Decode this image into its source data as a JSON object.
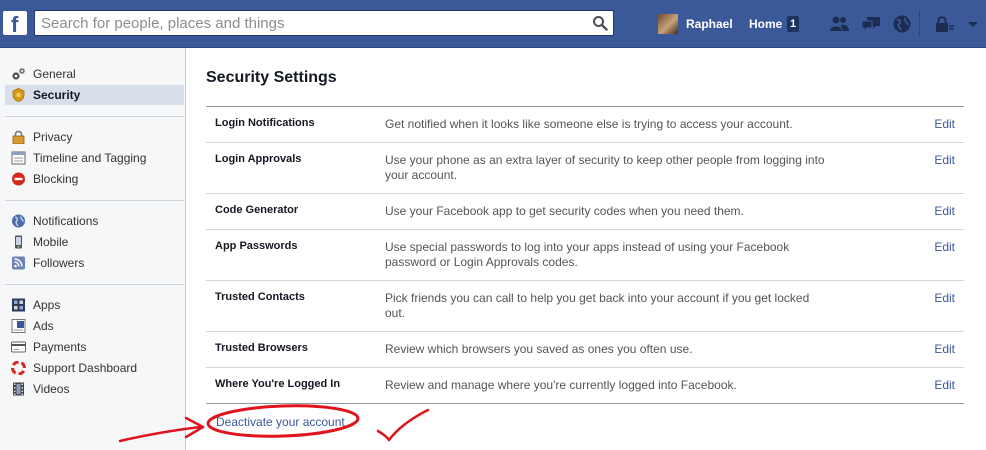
{
  "search": {
    "placeholder": "Search for people, places and things"
  },
  "header": {
    "logo_letter": "f",
    "user_name": "Raphael",
    "home_label": "Home",
    "home_count": "1"
  },
  "sidebar": {
    "items": [
      {
        "label": "General",
        "icon": "gears-icon"
      },
      {
        "label": "Security",
        "icon": "security-badge-icon",
        "selected": true
      },
      {
        "label": "Privacy",
        "icon": "padlock-icon"
      },
      {
        "label": "Timeline and Tagging",
        "icon": "timeline-icon"
      },
      {
        "label": "Blocking",
        "icon": "block-icon"
      },
      {
        "label": "Notifications",
        "icon": "globe-icon"
      },
      {
        "label": "Mobile",
        "icon": "mobile-phone-icon"
      },
      {
        "label": "Followers",
        "icon": "rss-icon"
      },
      {
        "label": "Apps",
        "icon": "apps-icon"
      },
      {
        "label": "Ads",
        "icon": "ads-icon"
      },
      {
        "label": "Payments",
        "icon": "credit-card-icon"
      },
      {
        "label": "Support Dashboard",
        "icon": "lifebuoy-icon"
      },
      {
        "label": "Videos",
        "icon": "film-icon"
      }
    ]
  },
  "main": {
    "title": "Security Settings",
    "edit_label": "Edit",
    "rows": [
      {
        "label": "Login Notifications",
        "desc": "Get notified when it looks like someone else is trying to access your account."
      },
      {
        "label": "Login Approvals",
        "desc": "Use your phone as an extra layer of security to keep other people from logging into your account."
      },
      {
        "label": "Code Generator",
        "desc": "Use your Facebook app to get security codes when you need them."
      },
      {
        "label": "App Passwords",
        "desc": "Use special passwords to log into your apps instead of using your Facebook password or Login Approvals codes."
      },
      {
        "label": "Trusted Contacts",
        "desc": "Pick friends you can call to help you get back into your account if you get locked out."
      },
      {
        "label": "Trusted Browsers",
        "desc": "Review which browsers you saved as ones you often use."
      },
      {
        "label": "Where You're Logged In",
        "desc": "Review and manage where you're currently logged into Facebook."
      }
    ],
    "deactivate_label": "Deactivate your account"
  },
  "colors": {
    "brand": "#3b5998",
    "link": "#3b5998",
    "annotation": "#e0141c"
  }
}
